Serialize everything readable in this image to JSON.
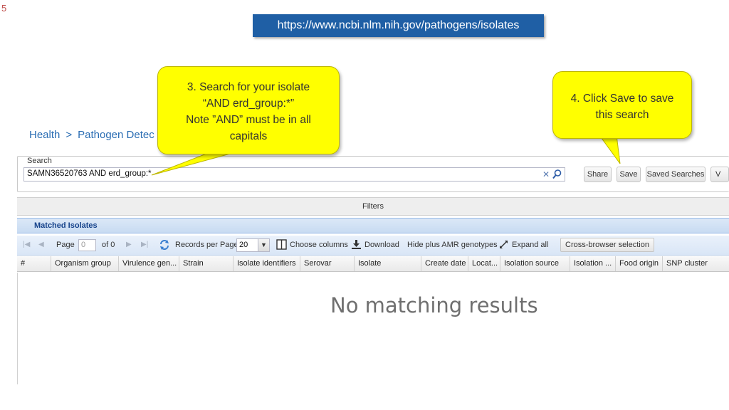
{
  "slide_number": "5",
  "url": "https://www.ncbi.nlm.nih.gov/pathogens/isolates",
  "breadcrumb": {
    "home": "Health",
    "separator": ">",
    "current": "Pathogen Detec"
  },
  "search": {
    "legend": "Search",
    "value": "SAMN36520763 AND erd_group:*",
    "clear_icon": "close-icon",
    "search_icon": "search-icon"
  },
  "toolbar": {
    "share_label": "Share",
    "save_label": "Save",
    "saved_searches_label": "Saved Searches",
    "overflow_label": "V"
  },
  "filters": {
    "label": "Filters"
  },
  "panel": {
    "title": "Matched Isolates"
  },
  "paging": {
    "page_label": "Page",
    "page_value": "0",
    "of_label": "of 0",
    "records_per_page_label": "Records per Page",
    "records_per_page_value": "20",
    "choose_columns_label": "Choose columns",
    "download_label": "Download",
    "hide_amr_label": "Hide plus AMR genotypes",
    "expand_all_label": "Expand all",
    "cross_browser_label": "Cross-browser selection"
  },
  "columns": [
    "#",
    "Organism group",
    "Virulence gen...",
    "Strain",
    "Isolate identifiers",
    "Serovar",
    "Isolate",
    "Create date",
    "Locat...",
    "Isolation source",
    "Isolation ...",
    "Food origin",
    "SNP cluster"
  ],
  "empty_message": "No matching results",
  "callouts": {
    "step3": {
      "line1": "3. Search for your isolate",
      "line2": "“AND erd_group:*”",
      "line3": "Note ”AND” must be in all",
      "line4": "capitals"
    },
    "step4": {
      "line1": "4. Click Save to save",
      "line2": "this search"
    }
  },
  "colors": {
    "url_bg": "#1f5fa5",
    "link_blue": "#2a6db3",
    "callout_yellow": "#ffff00",
    "panel_title": "#15428b",
    "slide_number": "#c0504d"
  }
}
